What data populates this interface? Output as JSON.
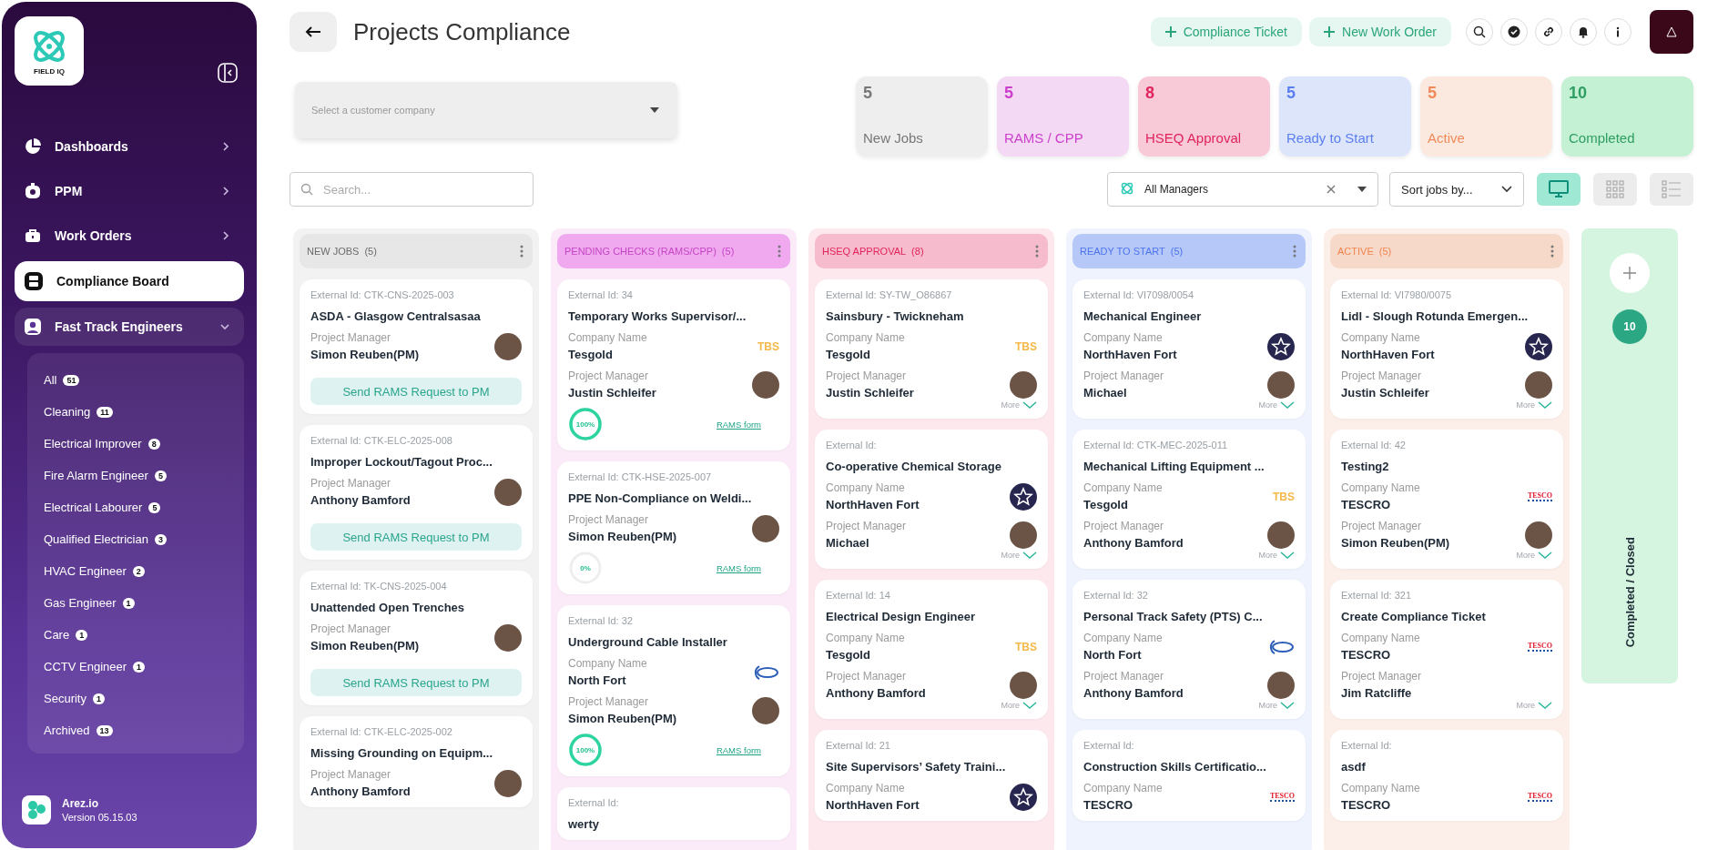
{
  "sidebar": {
    "logo_text": "FIELD IQ",
    "nav": [
      {
        "label": "Dashboards",
        "selected": false,
        "expanded": false
      },
      {
        "label": "PPM",
        "selected": false,
        "expanded": false
      },
      {
        "label": "Work Orders",
        "selected": false,
        "expanded": false
      },
      {
        "label": "Compliance Board",
        "selected": true
      },
      {
        "label": "Fast Track Engineers",
        "selected": false,
        "expanded": true
      }
    ],
    "sub_items": [
      {
        "label": "All",
        "count": "51",
        "selected": false
      },
      {
        "label": "Cleaning",
        "count": "11",
        "selected": false
      },
      {
        "label": "Electrical Improver",
        "count": "8",
        "selected": false
      },
      {
        "label": "Fire Alarm Engineer",
        "count": "5",
        "selected": false
      },
      {
        "label": "Electrical Labourer",
        "count": "5",
        "selected": false
      },
      {
        "label": "Qualified Electrician",
        "count": "3",
        "selected": false
      },
      {
        "label": "HVAC Engineer",
        "count": "2",
        "selected": false
      },
      {
        "label": "Gas Engineer",
        "count": "1",
        "selected": false
      },
      {
        "label": "Care",
        "count": "1",
        "selected": false
      },
      {
        "label": "CCTV Engineer",
        "count": "1",
        "selected": false
      },
      {
        "label": "Security",
        "count": "1",
        "selected": false
      },
      {
        "label": "Archived",
        "count": "13",
        "selected": false
      }
    ],
    "footer": {
      "name": "Arez.io",
      "version": "Version 05.15.03"
    }
  },
  "header": {
    "title": "Projects Compliance",
    "actions": [
      {
        "label": "Compliance Ticket"
      },
      {
        "label": "New Work Order"
      }
    ]
  },
  "customer_select": {
    "placeholder": "Select a customer company"
  },
  "stats": [
    {
      "kind": "new",
      "value": "5",
      "label": "New Jobs"
    },
    {
      "kind": "pending",
      "value": "5",
      "label": "RAMS / CPP"
    },
    {
      "kind": "hseq",
      "value": "8",
      "label": "HSEQ Approval"
    },
    {
      "kind": "ready",
      "value": "5",
      "label": "Ready to Start"
    },
    {
      "kind": "active",
      "value": "5",
      "label": "Active"
    },
    {
      "kind": "completed",
      "value": "10",
      "label": "Completed"
    }
  ],
  "filters": {
    "search": {
      "placeholder": "Search..."
    },
    "managers": {
      "value": "All Managers"
    },
    "sort": {
      "placeholder": "Sort jobs by..."
    },
    "views": [
      {
        "kind": "monitor",
        "selected": true
      },
      {
        "kind": "grid",
        "selected": false
      },
      {
        "kind": "list",
        "selected": false
      }
    ]
  },
  "columns": [
    {
      "kind": "new",
      "title": "NEW JOBS",
      "count": "(5)",
      "cards": [
        {
          "external_id": "External Id: CTK-CNS-2025-003",
          "title": "ASDA - Glasgow Centralsasaa",
          "manager": {
            "label": "Project Manager",
            "name": "Simon Reuben(PM)",
            "photo": true
          },
          "action": "Send RAMS Request to PM"
        },
        {
          "external_id": "External Id: CTK-ELC-2025-008",
          "title": "Improper Lockout/Tagout Proc...",
          "manager": {
            "label": "Project Manager",
            "name": "Anthony Bamford",
            "photo": true
          },
          "action": "Send RAMS Request to PM"
        },
        {
          "external_id": "External Id: TK-CNS-2025-004",
          "title": "Unattended Open Trenches",
          "manager": {
            "label": "Project Manager",
            "name": "Simon Reuben(PM)",
            "photo": true
          },
          "action": "Send RAMS Request to PM"
        },
        {
          "external_id": "External Id: CTK-ELC-2025-002",
          "title": "Missing Grounding on Equipm...",
          "manager": {
            "label": "Project Manager",
            "name": "Anthony Bamford",
            "photo": true
          }
        }
      ]
    },
    {
      "kind": "pending",
      "title": "PENDING CHECKS (RAMS/CPP)",
      "count": "(5)",
      "cards": [
        {
          "external_id": "External Id: 34",
          "title": "Temporary Works Supervisor/...",
          "company": {
            "label": "Company Name",
            "name": "Tesgold",
            "logo": {
              "kind": "tbs",
              "text": "TBS"
            }
          },
          "manager": {
            "label": "Project Manager",
            "name": "Justin Schleifer",
            "photo": true
          },
          "progress": {
            "level": 1,
            "label": "100%"
          },
          "link": "RAMS form"
        },
        {
          "external_id": "External Id: CTK-HSE-2025-007",
          "title": "PPE Non-Compliance on Weldi...",
          "manager": {
            "label": "Project Manager",
            "name": "Simon Reuben(PM)",
            "photo": true
          },
          "progress": {
            "level": 0,
            "label": "0%"
          },
          "link": "RAMS form"
        },
        {
          "external_id": "External Id: 32",
          "title": "Underground Cable Installer",
          "company": {
            "label": "Company Name",
            "name": "North Fort",
            "logo": {
              "kind": "ford"
            }
          },
          "manager": {
            "label": "Project Manager",
            "name": "Simon Reuben(PM)",
            "photo": true
          },
          "progress": {
            "level": 1,
            "label": "100%"
          },
          "link": "RAMS form"
        },
        {
          "external_id": "External Id:",
          "title": "werty"
        }
      ]
    },
    {
      "kind": "hseq",
      "title": "HSEQ APPROVAL",
      "count": "(8)",
      "cards": [
        {
          "external_id": "External Id: SY-TW_O86867",
          "title": "Sainsbury - Twickneham",
          "company": {
            "label": "Company Name",
            "name": "Tesgold",
            "logo": {
              "kind": "tbs",
              "text": "TBS"
            }
          },
          "manager": {
            "label": "Project Manager",
            "name": "Justin Schleifer",
            "photo": true
          },
          "more": "More"
        },
        {
          "external_id": "External Id:",
          "title": "Co-operative Chemical Storage",
          "company": {
            "label": "Company Name",
            "name": "NorthHaven Fort",
            "logo": {
              "kind": "star"
            }
          },
          "manager": {
            "label": "Project Manager",
            "name": "Michael",
            "photo": true
          },
          "more": "More"
        },
        {
          "external_id": "External Id: 14",
          "title": "Electrical Design Engineer",
          "company": {
            "label": "Company Name",
            "name": "Tesgold",
            "logo": {
              "kind": "tbs",
              "text": "TBS"
            }
          },
          "manager": {
            "label": "Project Manager",
            "name": "Anthony Bamford",
            "photo": true
          },
          "more": "More"
        },
        {
          "external_id": "External Id: 21",
          "title": "Site Supervisors’ Safety Traini...",
          "company": {
            "label": "Company Name",
            "name": "NorthHaven Fort",
            "logo": {
              "kind": "star"
            }
          }
        }
      ]
    },
    {
      "kind": "ready",
      "title": "READY TO START",
      "count": "(5)",
      "cards": [
        {
          "external_id": "External Id: VI7098/0054",
          "title": "Mechanical Engineer",
          "company": {
            "label": "Company Name",
            "name": "NorthHaven Fort",
            "logo": {
              "kind": "star"
            }
          },
          "manager": {
            "label": "Project Manager",
            "name": "Michael",
            "photo": true
          },
          "more": "More"
        },
        {
          "external_id": "External Id: CTK-MEC-2025-011",
          "title": "Mechanical Lifting Equipment ...",
          "company": {
            "label": "Company Name",
            "name": "Tesgold",
            "logo": {
              "kind": "tbs",
              "text": "TBS"
            }
          },
          "manager": {
            "label": "Project Manager",
            "name": "Anthony Bamford",
            "photo": true
          },
          "more": "More"
        },
        {
          "external_id": "External Id: 32",
          "title": "Personal Track Safety (PTS) C...",
          "company": {
            "label": "Company Name",
            "name": "North Fort",
            "logo": {
              "kind": "ford"
            }
          },
          "manager": {
            "label": "Project Manager",
            "name": "Anthony Bamford",
            "photo": true
          },
          "more": "More"
        },
        {
          "external_id": "External Id:",
          "title": "Construction Skills Certificatio...",
          "company": {
            "label": "Company Name",
            "name": "TESCRO",
            "logo": {
              "kind": "tesco",
              "text": "TESCO"
            }
          }
        }
      ]
    },
    {
      "kind": "active",
      "title": "ACTIVE",
      "count": "(5)",
      "cards": [
        {
          "external_id": "External Id: VI7980/0075",
          "title": "Lidl - Slough Rotunda Emergen...",
          "company": {
            "label": "Company Name",
            "name": "NorthHaven Fort",
            "logo": {
              "kind": "star"
            }
          },
          "manager": {
            "label": "Project Manager",
            "name": "Justin Schleifer",
            "photo": true
          },
          "more": "More"
        },
        {
          "external_id": "External Id: 42",
          "title": "Testing2",
          "company": {
            "label": "Company Name",
            "name": "TESCRO",
            "logo": {
              "kind": "tesco",
              "text": "TESCO"
            }
          },
          "manager": {
            "label": "Project Manager",
            "name": "Simon Reuben(PM)",
            "photo": true
          },
          "more": "More"
        },
        {
          "external_id": "External Id: 321",
          "title": "Create Compliance Ticket",
          "company": {
            "label": "Company Name",
            "name": "TESCRO",
            "logo": {
              "kind": "tesco",
              "text": "TESCO"
            }
          },
          "manager": {
            "label": "Project Manager",
            "name": "Jim Ratcliffe",
            "photo": false
          },
          "more": "More"
        },
        {
          "external_id": "External Id:",
          "title": "asdf",
          "company": {
            "label": "Company Name",
            "name": "TESCRO",
            "logo": {
              "kind": "tesco",
              "text": "TESCO"
            }
          }
        }
      ]
    }
  ],
  "completed_column": {
    "count": "10",
    "label": "Completed / Closed"
  }
}
